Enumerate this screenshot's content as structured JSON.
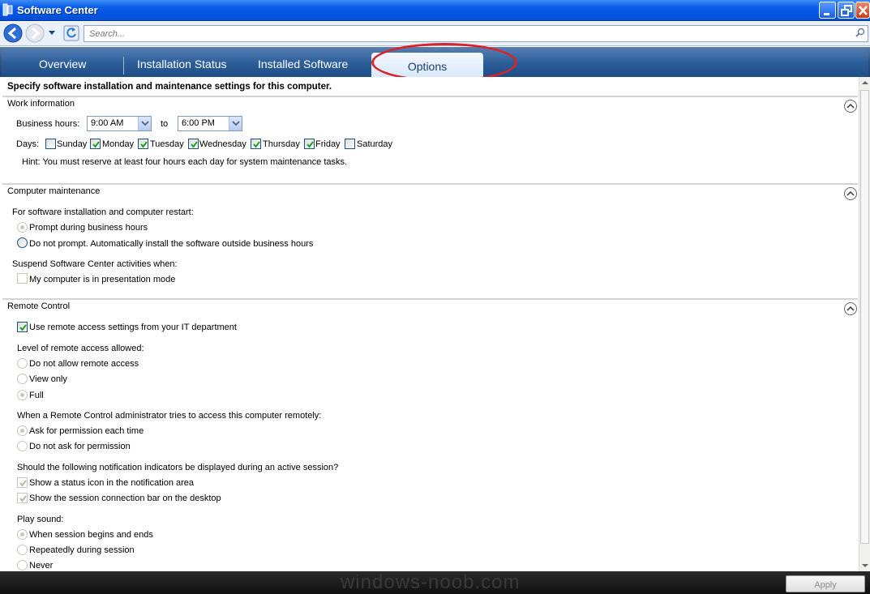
{
  "window": {
    "title": "Software Center"
  },
  "nav": {
    "search_placeholder": "Search..."
  },
  "tabs": [
    {
      "label": "Overview"
    },
    {
      "label": "Installation Status"
    },
    {
      "label": "Installed Software"
    },
    {
      "label": "Options"
    }
  ],
  "intro": "Specify software installation and maintenance settings for this computer.",
  "work": {
    "title": "Work information",
    "business_hours_label": "Business hours:",
    "start_time": "9:00 AM",
    "to_label": "to",
    "end_time": "6:00 PM",
    "days_label": "Days:",
    "days": [
      {
        "label": "Sunday",
        "checked": false
      },
      {
        "label": "Monday",
        "checked": true
      },
      {
        "label": "Tuesday",
        "checked": true
      },
      {
        "label": "Wednesday",
        "checked": true
      },
      {
        "label": "Thursday",
        "checked": true
      },
      {
        "label": "Friday",
        "checked": true
      },
      {
        "label": "Saturday",
        "checked": false
      }
    ],
    "hint": "Hint: You must reserve at least four hours each day for system maintenance tasks."
  },
  "maintenance": {
    "title": "Computer maintenance",
    "restart_label": "For software installation and computer restart:",
    "opt_prompt": "Prompt during business hours",
    "opt_noprompt": "Do not prompt. Automatically install the software outside business hours",
    "suspend_label": "Suspend Software Center activities when:",
    "presentation": "My computer is in presentation mode"
  },
  "remote": {
    "title": "Remote Control",
    "use_it_settings": "Use remote access settings from your IT department",
    "level_label": "Level of remote access allowed:",
    "level_options": [
      "Do not allow remote access",
      "View only",
      "Full"
    ],
    "admin_label": "When a Remote Control administrator tries to access this computer remotely:",
    "admin_options": [
      "Ask for permission each time",
      "Do not ask for permission"
    ],
    "notify_label": "Should the following notification indicators be displayed during an active session?",
    "notify_options": [
      "Show a status icon in the notification area",
      "Show the session connection bar on the desktop"
    ],
    "sound_label": "Play sound:",
    "sound_options": [
      "When session begins and ends",
      "Repeatedly during session",
      "Never"
    ]
  },
  "footer": {
    "watermark": "windows-noob.com",
    "apply": "Apply"
  }
}
